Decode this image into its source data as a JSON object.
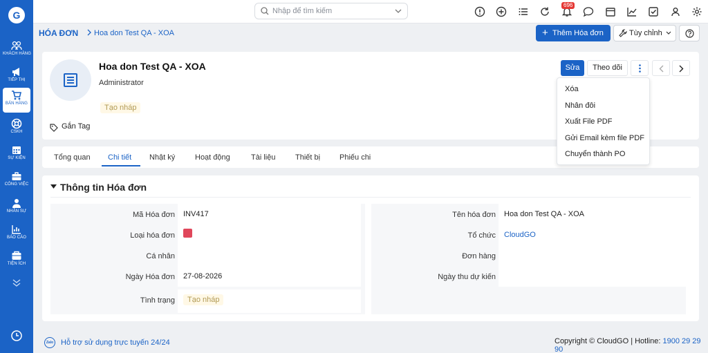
{
  "sidebar": {
    "logo": "G",
    "items": [
      {
        "label": "KHÁCH HÀNG",
        "icon": "customers-icon"
      },
      {
        "label": "TIẾP THỊ",
        "icon": "megaphone-icon"
      },
      {
        "label": "BÁN HÀNG",
        "icon": "cart-icon"
      },
      {
        "label": "CSKH",
        "icon": "lifebuoy-icon"
      },
      {
        "label": "SỰ KIỆN",
        "icon": "calendar-icon"
      },
      {
        "label": "CÔNG VIỆC",
        "icon": "briefcase-icon"
      },
      {
        "label": "NHÂN SỰ",
        "icon": "person-icon"
      },
      {
        "label": "BÁO CÁO",
        "icon": "report-icon"
      },
      {
        "label": "TIỆN ÍCH",
        "icon": "utilities-icon"
      }
    ],
    "active_index": 2
  },
  "topbar": {
    "search_placeholder": "Nhập để tìm kiếm",
    "notification_count": "696"
  },
  "breadcrumb": {
    "root": "HÓA ĐƠN",
    "current": "Hoa don Test QA - XOA"
  },
  "actions": {
    "add_label": "Thêm Hóa đơn",
    "custom_label": "Tùy chỉnh"
  },
  "record": {
    "title": "Hoa don Test QA - XOA",
    "owner": "Administrator",
    "status": "Tạo nháp",
    "tag_label": "Gắn Tag",
    "edit_label": "Sửa",
    "follow_label": "Theo dõi"
  },
  "more_menu": [
    "Xóa",
    "Nhân đôi",
    "Xuất File PDF",
    "Gửi Email kèm file PDF",
    "Chuyển thành PO"
  ],
  "tabs": [
    "Tổng quan",
    "Chi tiết",
    "Nhật ký",
    "Hoạt động",
    "Tài liệu",
    "Thiết bị",
    "Phiếu chi"
  ],
  "active_tab": 1,
  "section": {
    "title": "Thông tin Hóa đơn",
    "left_fields": [
      {
        "label": "Mã Hóa đơn",
        "value": "INV417"
      },
      {
        "label": "Loại hóa đơn",
        "value": ""
      },
      {
        "label": "Cá nhân",
        "value": ""
      },
      {
        "label": "Ngày Hóa đơn",
        "value": "27-08-2026"
      },
      {
        "label": "Tình trạng",
        "value": "Tạo nháp"
      }
    ],
    "right_fields": [
      {
        "label": "Tên hóa đơn",
        "value": "Hoa don Test QA - XOA"
      },
      {
        "label": "Tổ chức",
        "value": "CloudGO"
      },
      {
        "label": "Đơn hàng",
        "value": ""
      },
      {
        "label": "Ngày thu dự kiến",
        "value": ""
      }
    ],
    "type_color": "#e0475b"
  },
  "footer": {
    "zalo": "Zalo",
    "support": "Hỗ trợ sử dụng trực tuyến 24/24",
    "copyright": "Copyright © CloudGO | Hotline:",
    "hotline": "1900 29 29 90"
  },
  "colors": {
    "primary": "#1b63c6",
    "status_bg": "#fff8e6",
    "status_text": "#b19a54"
  }
}
